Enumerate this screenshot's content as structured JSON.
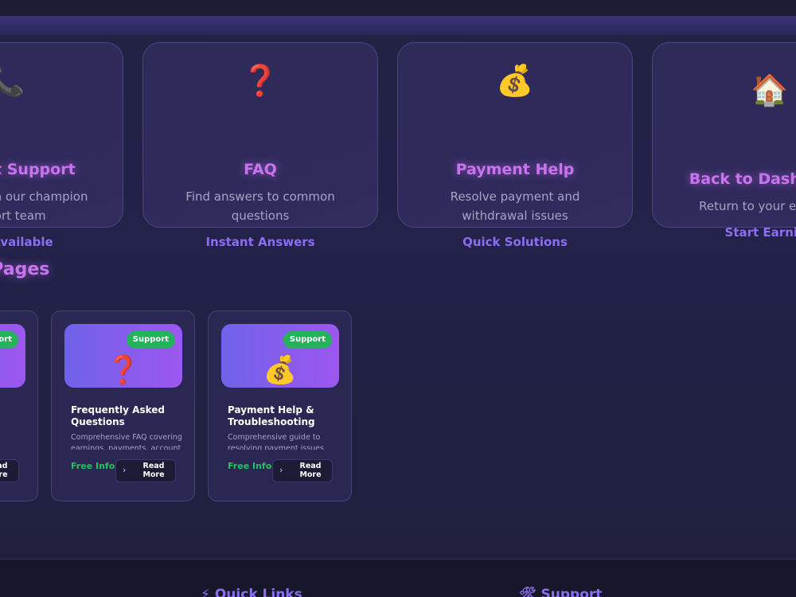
{
  "cards": [
    {
      "icon": "📞",
      "title": "Contact Support",
      "desc": "Connect with our champion support team",
      "badge": "24/7 Available"
    },
    {
      "icon": "❓",
      "title": "FAQ",
      "desc": "Find answers to common questions",
      "badge": "Instant Answers"
    },
    {
      "icon": "💰",
      "title": "Payment Help",
      "desc": "Resolve payment and withdrawal issues",
      "badge": "Quick Solutions"
    },
    {
      "icon": "🏠",
      "title": "Back to Dashboard",
      "desc": "Return to your earnings",
      "badge": "Start Earning"
    }
  ],
  "section_title": "Support Pages",
  "pages": [
    {
      "tag": "Support",
      "icon": "📞",
      "title": "",
      "desc": "",
      "free": "",
      "btn": "Read More"
    },
    {
      "tag": "Support",
      "icon": "❓",
      "title": "Frequently Asked Questions",
      "desc": "Comprehensive FAQ covering earnings, payments, account",
      "free": "Free Info",
      "btn": "Read More"
    },
    {
      "tag": "Support",
      "icon": "💰",
      "title": "Payment Help & Troubleshooting",
      "desc": "Comprehensive guide to resolving payment issues",
      "free": "Free Info",
      "btn": "Read More"
    }
  ],
  "footer": {
    "quick_links_icon": "⚡",
    "quick_links": "Quick Links",
    "support_icon": "🛠",
    "support": "Support"
  },
  "colors": {
    "accent": "#c973f0",
    "badge": "#8d6ef2",
    "tag": "#22b35b",
    "free": "#22c25c"
  }
}
